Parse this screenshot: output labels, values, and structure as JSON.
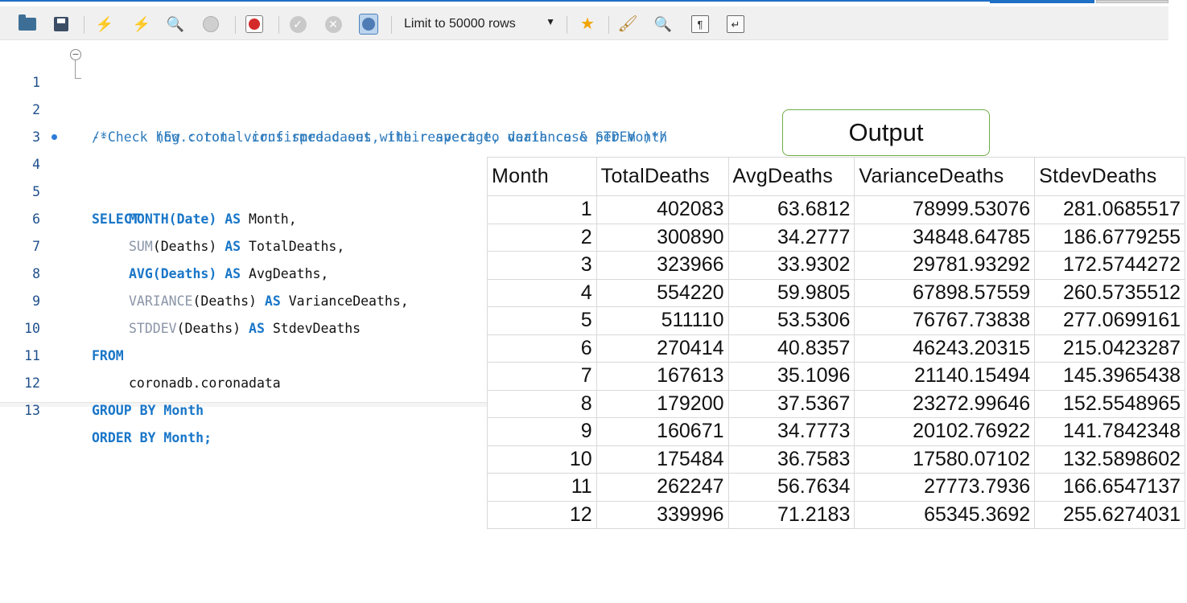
{
  "toolbar": {
    "limit_label": "Limit to 50000 rows",
    "icons": [
      "folder-open-icon",
      "save-icon",
      "execute-icon",
      "execute-statement-icon",
      "explain-icon",
      "stop-icon",
      "toggle-continue-on-error-icon",
      "commit-icon",
      "rollback-icon",
      "autocommit-icon",
      "limit-rows-select",
      "bookmark-star-icon",
      "beautify-icon",
      "find-icon",
      "invisible-chars-icon",
      "word-wrap-icon"
    ]
  },
  "editor": {
    "lines": [
      {
        "n": "1",
        "text": "/*Check how corona virus spread out with respect to death case per month"
      },
      {
        "n": "2",
        "text": "--      (Eg.: total confirmed cases, their average, variance & STDEV )*/"
      },
      {
        "n": "3",
        "text": ""
      },
      {
        "n": "4",
        "text": "SELECT"
      },
      {
        "n": "5",
        "fn": "MONTH(Date)",
        "as": "AS",
        "alias": "Month,"
      },
      {
        "n": "6",
        "fn_name": "SUM",
        "fn_arg": "(Deaths)",
        "as": "AS",
        "alias": "TotalDeaths,"
      },
      {
        "n": "7",
        "fn": "AVG(Deaths)",
        "as": "AS",
        "alias": "AvgDeaths,"
      },
      {
        "n": "8",
        "fn_name": "VARIANCE",
        "fn_arg": "(Deaths)",
        "as": "AS",
        "alias": "VarianceDeaths,"
      },
      {
        "n": "9",
        "fn_name": "STDDEV",
        "fn_arg": "(Deaths)",
        "as": "AS",
        "alias": "StdevDeaths"
      },
      {
        "n": "10",
        "text": "FROM"
      },
      {
        "n": "11",
        "text": "coronadb.coronadata"
      },
      {
        "n": "12",
        "kw": "GROUP BY",
        "ident": "Month"
      },
      {
        "n": "13",
        "kw": "ORDER BY",
        "ident": "Month;"
      }
    ]
  },
  "output_label": "Output",
  "result": {
    "columns": [
      "Month",
      "TotalDeaths",
      "AvgDeaths",
      "VarianceDeaths",
      "StdevDeaths"
    ],
    "rows": [
      [
        "1",
        "402083",
        "63.6812",
        "78999.53076",
        "281.0685517"
      ],
      [
        "2",
        "300890",
        "34.2777",
        "34848.64785",
        "186.6779255"
      ],
      [
        "3",
        "323966",
        "33.9302",
        "29781.93292",
        "172.5744272"
      ],
      [
        "4",
        "554220",
        "59.9805",
        "67898.57559",
        "260.5735512"
      ],
      [
        "5",
        "511110",
        "53.5306",
        "76767.73838",
        "277.0699161"
      ],
      [
        "6",
        "270414",
        "40.8357",
        "46243.20315",
        "215.0423287"
      ],
      [
        "7",
        "167613",
        "35.1096",
        "21140.15494",
        "145.3965438"
      ],
      [
        "8",
        "179200",
        "37.5367",
        "23272.99646",
        "152.5548965"
      ],
      [
        "9",
        "160671",
        "34.7773",
        "20102.76922",
        "141.7842348"
      ],
      [
        "10",
        "175484",
        "36.7583",
        "17580.07102",
        "132.5898602"
      ],
      [
        "11",
        "262247",
        "56.7634",
        "27773.7936",
        "166.6547137"
      ],
      [
        "12",
        "339996",
        "71.2183",
        "65345.3692",
        "255.6274031"
      ]
    ]
  }
}
